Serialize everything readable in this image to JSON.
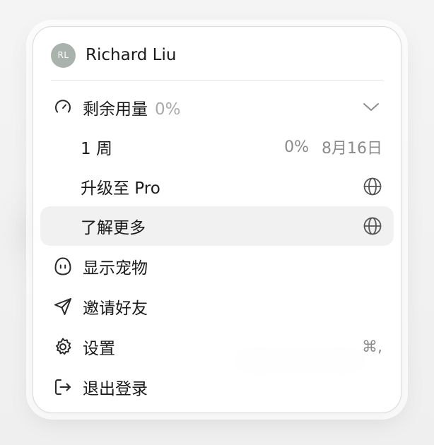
{
  "user": {
    "initials": "RL",
    "name": "Richard Liu"
  },
  "usage": {
    "label": "剩余用量",
    "percent": "0%",
    "icon": "gauge-icon",
    "expand_icon": "chevron-down-icon",
    "period": {
      "label": "1 周",
      "percent": "0%",
      "reset_date": "8月16日"
    }
  },
  "items": {
    "upgrade": {
      "label": "升级至 Pro",
      "icon": "globe-icon"
    },
    "learn_more": {
      "label": "了解更多",
      "icon": "globe-icon",
      "highlighted": true
    },
    "show_pet": {
      "label": "显示宠物",
      "icon": "pet-icon"
    },
    "invite": {
      "label": "邀请好友",
      "icon": "send-icon"
    },
    "settings": {
      "label": "设置",
      "icon": "gear-icon",
      "shortcut": "⌘,"
    },
    "logout": {
      "label": "退出登录",
      "icon": "logout-icon"
    }
  },
  "colors": {
    "avatar": "#a9b2ad",
    "highlight": "#f1f1f1",
    "text": "#1a1a1a",
    "muted": "#8b8b8b"
  }
}
